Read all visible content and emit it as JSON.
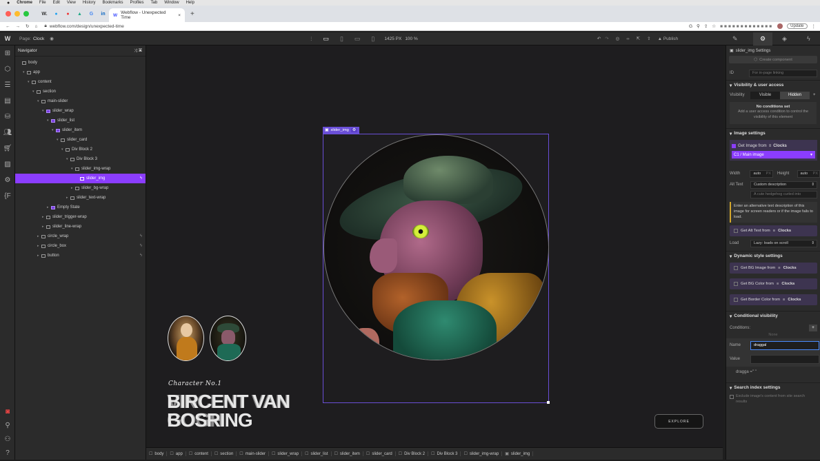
{
  "mac": {
    "apple": "",
    "items": [
      "Chrome",
      "File",
      "Edit",
      "View",
      "History",
      "Bookmarks",
      "Profiles",
      "Tab",
      "Window",
      "Help"
    ]
  },
  "browser": {
    "tab_title": "Webflow - Unexpected Time",
    "url": "webflow.com/design/unexpected-time",
    "update_label": "Update",
    "favicons": [
      "W.",
      "",
      "",
      "G",
      "",
      "in"
    ]
  },
  "topbar": {
    "page_label": "Page:",
    "page_name": "Clock",
    "canvas_size": "1425 PX",
    "zoom": "100 %",
    "publish": "Publish"
  },
  "navigator": {
    "title": "Navigator",
    "rows": [
      {
        "label": "body",
        "depth": 0,
        "kind": "el",
        "caret": ""
      },
      {
        "label": "app",
        "depth": 1,
        "kind": "el",
        "caret": "▾"
      },
      {
        "label": "content",
        "depth": 2,
        "kind": "el",
        "caret": "▾"
      },
      {
        "label": "section",
        "depth": 3,
        "kind": "el",
        "caret": "▾"
      },
      {
        "label": "main-slider",
        "depth": 4,
        "kind": "el",
        "caret": "▾"
      },
      {
        "label": "slider_wrap",
        "depth": 5,
        "kind": "comp",
        "caret": "▾"
      },
      {
        "label": "slider_list",
        "depth": 6,
        "kind": "comp",
        "caret": "▾"
      },
      {
        "label": "slider_item",
        "depth": 7,
        "kind": "comp",
        "caret": "▾"
      },
      {
        "label": "slider_card",
        "depth": 8,
        "kind": "el",
        "caret": "▾"
      },
      {
        "label": "Div Block 2",
        "depth": 9,
        "kind": "el",
        "caret": "▾"
      },
      {
        "label": "Div Block 3",
        "depth": 10,
        "kind": "el",
        "caret": "▾"
      },
      {
        "label": "slider_img-wrap",
        "depth": 11,
        "kind": "el",
        "caret": "▾"
      },
      {
        "label": "slider_img",
        "depth": 12,
        "kind": "img",
        "caret": "",
        "sel": true
      },
      {
        "label": "slider_bg-wrap",
        "depth": 11,
        "kind": "el",
        "caret": "▸"
      },
      {
        "label": "slider_text-wrap",
        "depth": 10,
        "kind": "el",
        "caret": "▸"
      },
      {
        "label": "Empty State",
        "depth": 6,
        "kind": "comp",
        "caret": "▸"
      },
      {
        "label": "slider_trigger-wrap",
        "depth": 5,
        "kind": "el",
        "caret": "▸"
      },
      {
        "label": "slider_line-wrap",
        "depth": 5,
        "kind": "el",
        "caret": "▸"
      },
      {
        "label": "circle_wrap",
        "depth": 4,
        "kind": "el",
        "caret": "▸",
        "bolt": true
      },
      {
        "label": "circle_box",
        "depth": 4,
        "kind": "el",
        "caret": "▸",
        "bolt": true
      },
      {
        "label": "button",
        "depth": 4,
        "kind": "el",
        "caret": "▸",
        "bolt": true
      }
    ]
  },
  "canvas": {
    "selected_label": "slider_img",
    "char_caption": "Character No.1",
    "title_line1": "VINCENT VAN",
    "title_line2": "GOGH",
    "title_line1b": "BIRCENT VAN",
    "title_line2b": "BOSRING",
    "explore": "EXPLORE"
  },
  "settings": {
    "header": "slider_img Settings",
    "create_component": "Create component",
    "id_label": "ID",
    "id_placeholder": "For in-page linking",
    "visibility_section": "Visibility & user access",
    "visibility_label": "Visibility",
    "visible": "Visible",
    "hidden": "Hidden",
    "no_conditions": "No conditions set",
    "no_cond_desc": "Add a user access condition to control the visibility of this element",
    "image_section": "Image settings",
    "get_image": "Get Image from",
    "clocks": "Clocks",
    "main_image": "C1 / Main image",
    "width_label": "Width",
    "width_val": "auto",
    "px": "PX",
    "height_label": "Height",
    "height_val": "auto",
    "alt_label": "Alt Text",
    "alt_select": "Custom description",
    "alt_placeholder": "A cute hedgehog curled into",
    "alt_help": "Enter an alternative text description of this image for screen readers or if the image fails to load.",
    "get_alt": "Get Alt Text from",
    "load_label": "Load",
    "load_val": "Lazy: loads on scroll",
    "dynamic_section": "Dynamic style settings",
    "get_bg_img": "Get BG Image from",
    "get_bg_color": "Get BG Color from",
    "get_border": "Get Border Color from",
    "cond_section": "Conditional visibility",
    "conditions": "Conditions:",
    "none": "None",
    "name_label": "Name",
    "name_val": "draggal",
    "value_label": "Value",
    "dragga": "dragga =\" \"",
    "search_section": "Search index settings",
    "search_desc": "Exclude image's content from site search results"
  },
  "breadcrumb": [
    "body",
    "app",
    "content",
    "section",
    "main-slider",
    "slider_wrap",
    "slider_list",
    "slider_item",
    "slider_card",
    "Div Block 2",
    "Div Block 3",
    "slider_img-wrap",
    "slider_img"
  ],
  "colors": {
    "accent": "#8b3dff",
    "selection": "#6a4fd8"
  }
}
